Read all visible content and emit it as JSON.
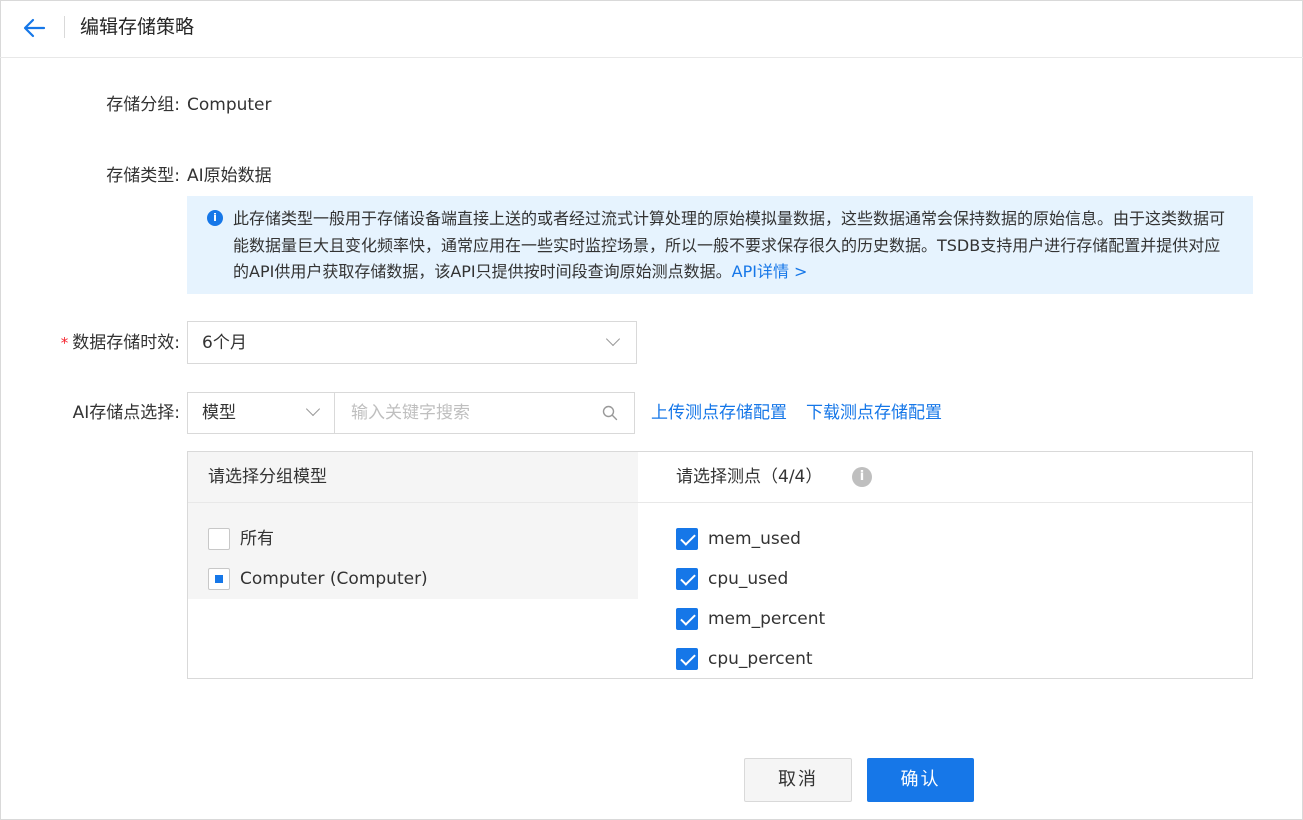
{
  "header": {
    "title": "编辑存储策略"
  },
  "form": {
    "group": {
      "label": "存储分组:",
      "value": "Computer"
    },
    "type": {
      "label": "存储类型:",
      "value": "AI原始数据"
    },
    "info": {
      "icon": "info-icon",
      "text": "此存储类型一般用于存储设备端直接上送的或者经过流式计算处理的原始模拟量数据，这些数据通常会保持数据的原始信息。由于这类数据可能数据量巨大且变化频率快，通常应用在一些实时监控场景，所以一般不要求保存很久的历史数据。TSDB支持用户进行存储配置并提供对应的API供用户获取存储数据，该API只提供按时间段查询原始测点数据。",
      "link": "API详情 >"
    },
    "retention": {
      "required_mark": "*",
      "label": "数据存储时效:",
      "selected": "6个月"
    },
    "points": {
      "label": "AI存储点选择:",
      "filter_selected": "模型",
      "search_placeholder": "输入关键字搜索",
      "upload_link": "上传测点存储配置",
      "download_link": "下载测点存储配置"
    }
  },
  "transfer": {
    "left": {
      "title": "请选择分组模型",
      "items": [
        {
          "label": "所有",
          "state": "unchecked"
        },
        {
          "label": "Computer (Computer)",
          "state": "indeterminate"
        }
      ]
    },
    "right": {
      "title": "请选择测点（4/4）",
      "help_icon": "help-icon",
      "items": [
        {
          "label": "mem_used",
          "state": "checked"
        },
        {
          "label": "cpu_used",
          "state": "checked"
        },
        {
          "label": "mem_percent",
          "state": "checked"
        },
        {
          "label": "cpu_percent",
          "state": "checked"
        }
      ]
    }
  },
  "footer": {
    "cancel_label": "取消",
    "ok_label": "确认"
  },
  "colors": {
    "accent": "#1677e8",
    "info_bg": "#e6f3fe",
    "required": "#f5222d"
  }
}
